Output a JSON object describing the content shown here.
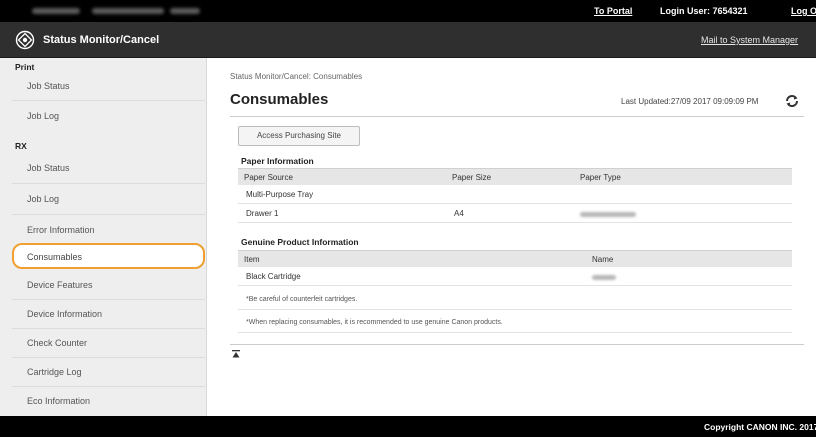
{
  "topbar": {
    "to_portal": "To Portal",
    "login_user": "Login User:  7654321",
    "log_out": "Log Out"
  },
  "header": {
    "title": "Status Monitor/Cancel",
    "mail_link": "Mail to System Manager"
  },
  "sidebar": {
    "sections": [
      {
        "heading": "Print",
        "items": [
          "Job Status",
          "Job Log"
        ]
      },
      {
        "heading": "RX",
        "items": [
          "Job Status",
          "Job Log"
        ]
      }
    ],
    "items": [
      "Error Information",
      "Consumables",
      "Device Features",
      "Device Information",
      "Check Counter",
      "Cartridge Log",
      "Eco Information"
    ],
    "active_item": "Consumables"
  },
  "main": {
    "breadcrumb": "Status Monitor/Cancel: Consumables",
    "title": "Consumables",
    "last_updated": "Last Updated:27/09 2017 09:09:09 PM",
    "access_button": "Access Purchasing Site",
    "paper": {
      "title": "Paper Information",
      "headers": [
        "Paper Source",
        "Paper Size",
        "Paper Type"
      ],
      "rows": [
        [
          "Multi-Purpose Tray",
          "",
          ""
        ],
        [
          "Drawer 1",
          "A4",
          ""
        ]
      ]
    },
    "genuine": {
      "title": "Genuine Product Information",
      "headers": [
        "Item",
        "Name"
      ],
      "rows": [
        [
          "Black Cartridge",
          ""
        ]
      ]
    },
    "notes": [
      "*Be careful of counterfeit cartridges.",
      "*When replacing consumables, it is recommended to use genuine Canon products."
    ]
  },
  "footer": {
    "copyright": "Copyright CANON INC. 2017"
  },
  "colors": {
    "highlight": "#f0a030",
    "topbar": "#000000",
    "titlebar": "#2f2f2f",
    "sidebar": "#eeeeee"
  }
}
